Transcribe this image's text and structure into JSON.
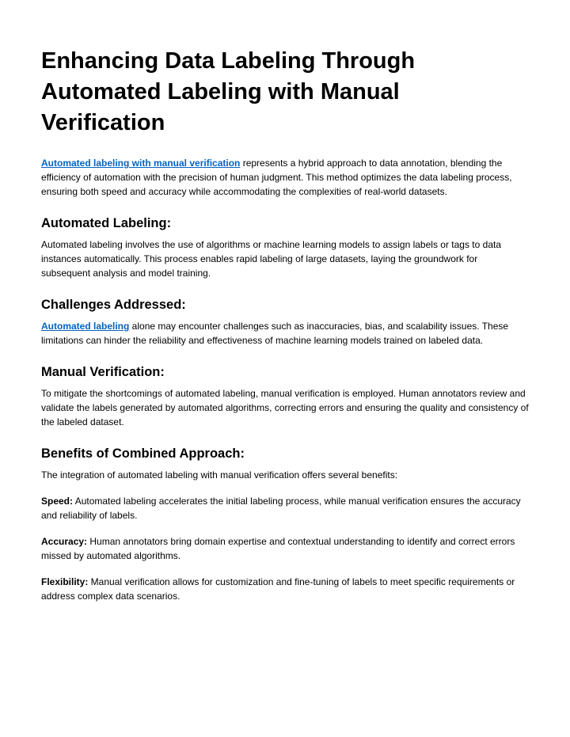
{
  "title": "Enhancing Data Labeling Through Automated Labeling with Manual Verification",
  "intro": {
    "link_text": "Automated labeling with manual verification",
    "body": " represents a hybrid approach to data annotation, blending the efficiency of automation with the precision of human judgment. This method optimizes the data labeling process, ensuring both speed and accuracy while accommodating the complexities of real-world datasets."
  },
  "sections": {
    "automated_labeling": {
      "heading": "Automated Labeling:",
      "body": "Automated labeling involves the use of algorithms or machine learning models to assign labels or tags to data instances automatically. This process enables rapid labeling of large datasets, laying the groundwork for subsequent analysis and model training."
    },
    "challenges": {
      "heading": "Challenges Addressed:",
      "link_text": "Automated labeling",
      "body": " alone may encounter challenges such as inaccuracies, bias, and scalability issues. These limitations can hinder the reliability and effectiveness of machine learning models trained on labeled data."
    },
    "manual_verification": {
      "heading": "Manual Verification:",
      "body": "To mitigate the shortcomings of automated labeling, manual verification is employed. Human annotators review and validate the labels generated by automated algorithms, correcting errors and ensuring the quality and consistency of the labeled dataset."
    },
    "benefits": {
      "heading": "Benefits of Combined Approach:",
      "intro": "The integration of automated labeling with manual verification offers several benefits:",
      "items": {
        "speed": {
          "label": "Speed:",
          "text": " Automated labeling accelerates the initial labeling process, while manual verification ensures the accuracy and reliability of labels."
        },
        "accuracy": {
          "label": "Accuracy:",
          "text": " Human annotators bring domain expertise and contextual understanding to identify and correct errors missed by automated algorithms."
        },
        "flexibility": {
          "label": "Flexibility:",
          "text": " Manual verification allows for customization and fine-tuning of labels to meet specific requirements or address complex data scenarios."
        }
      }
    }
  }
}
